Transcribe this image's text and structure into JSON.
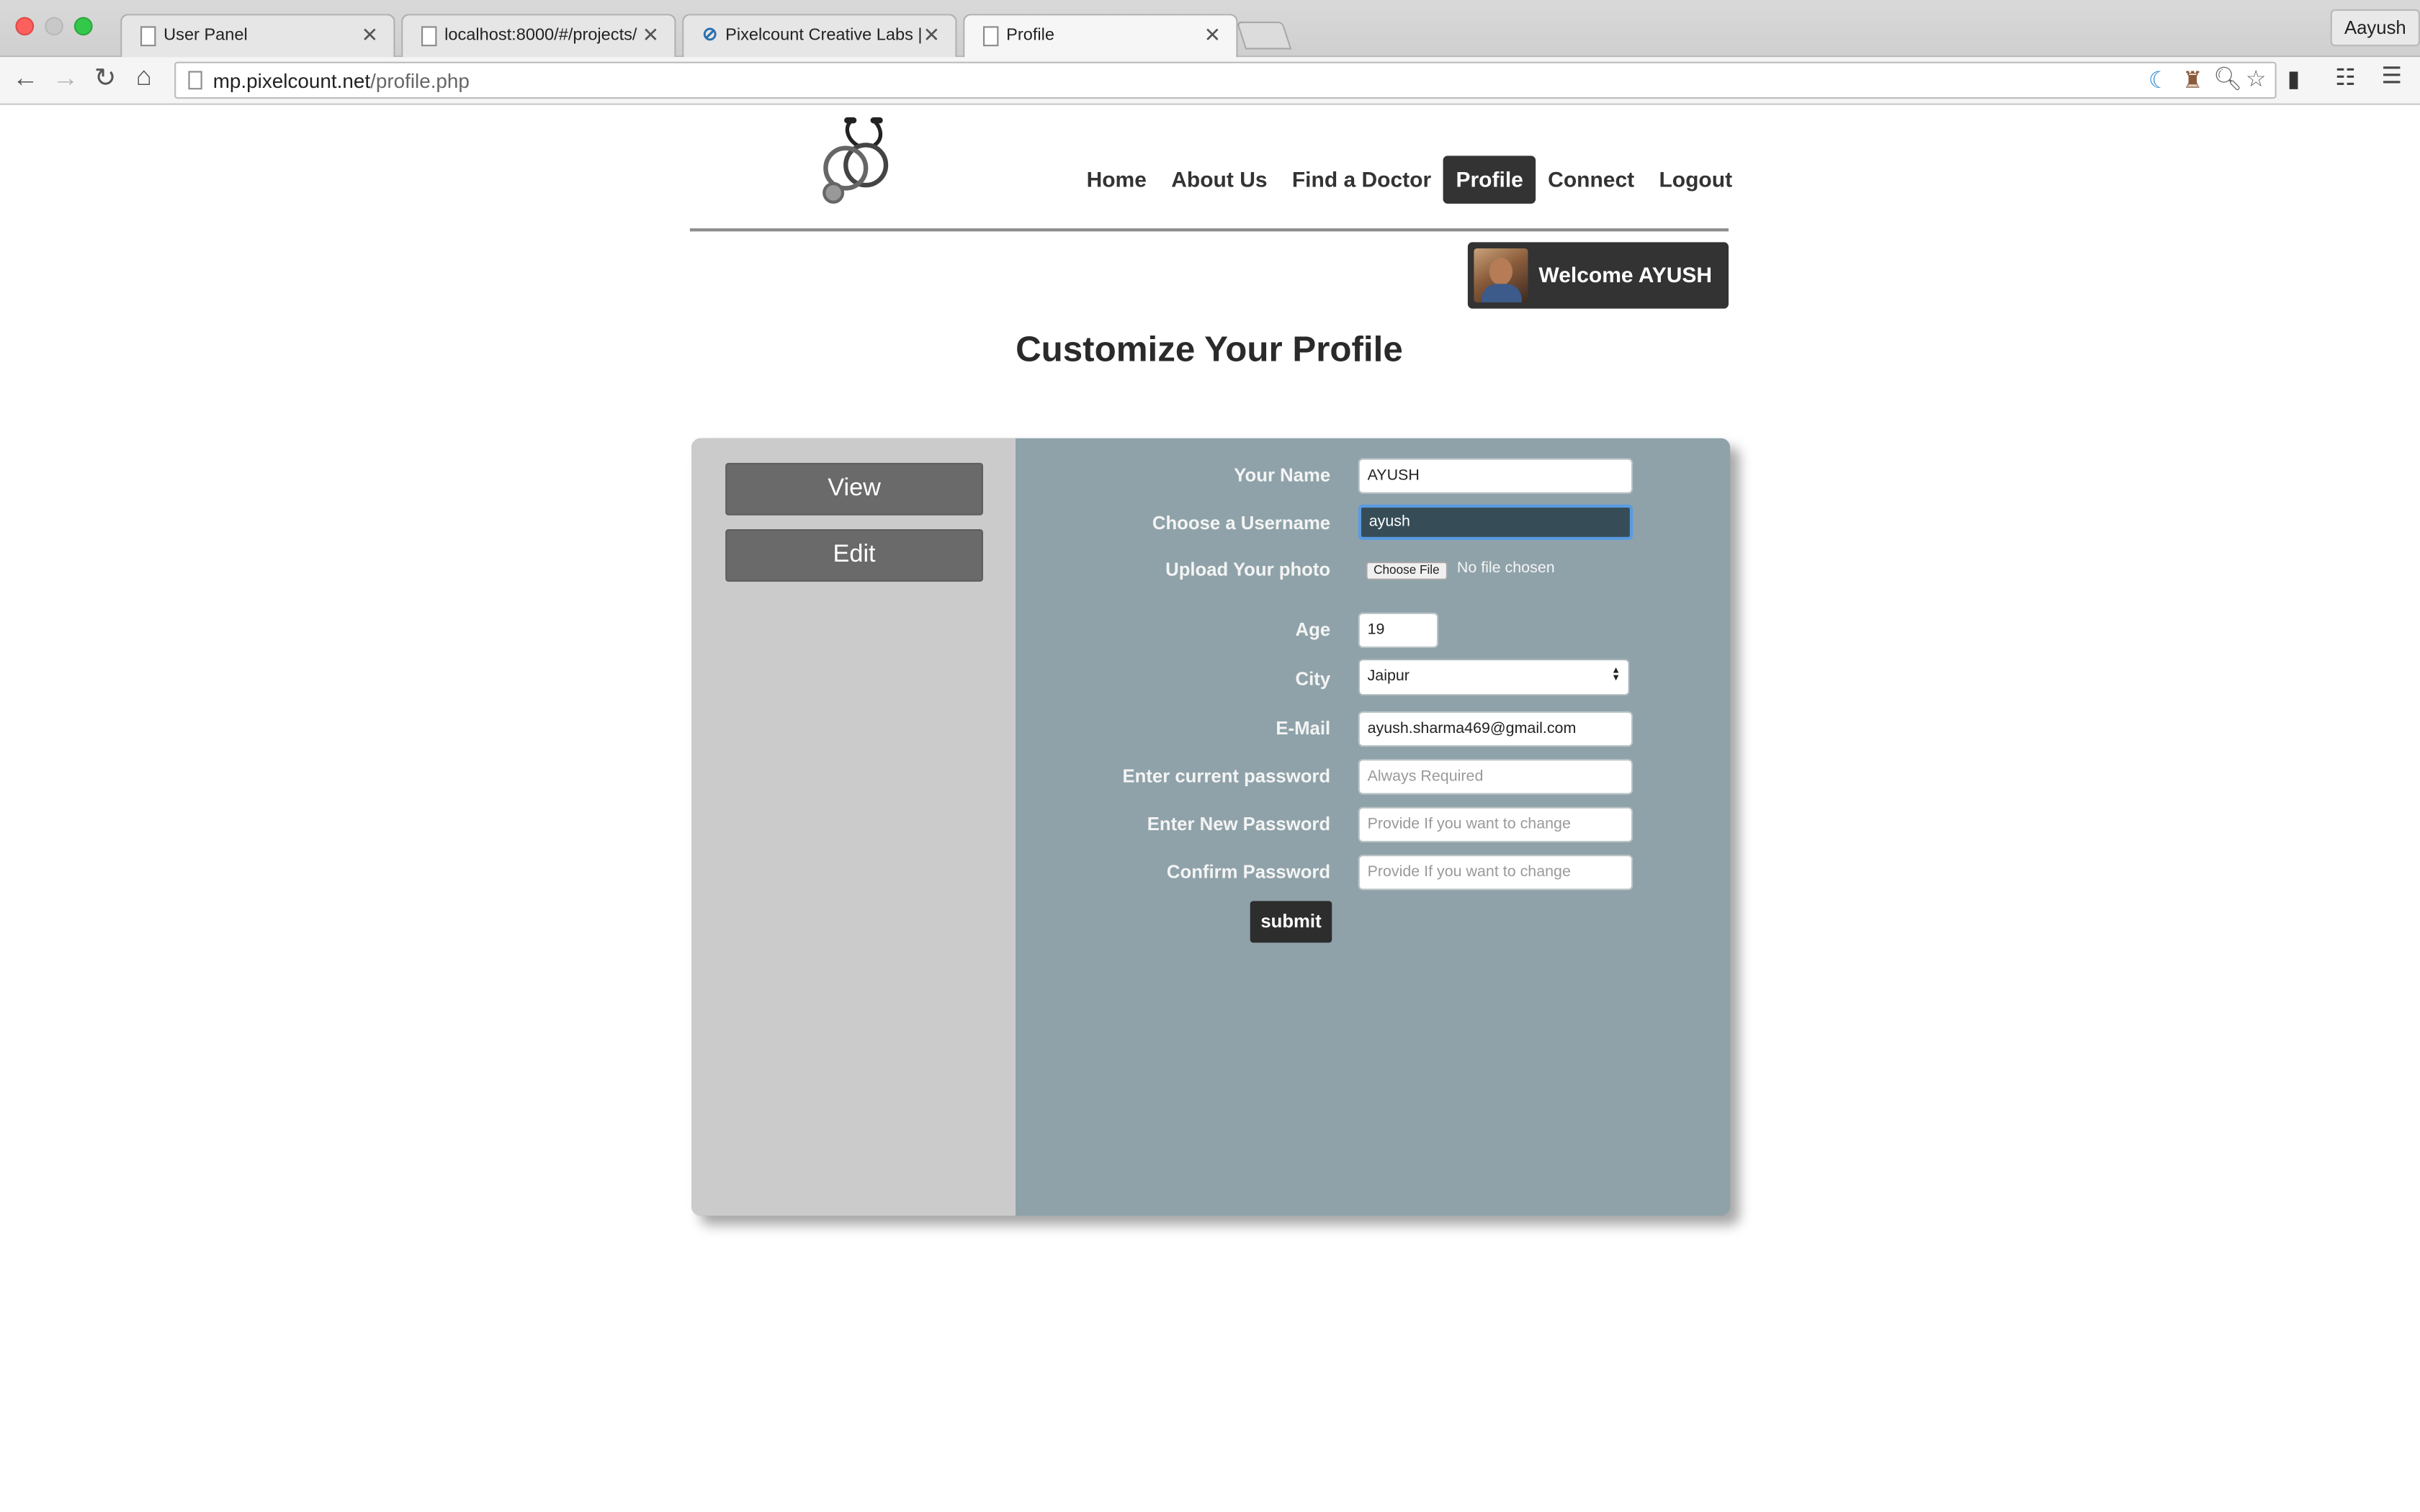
{
  "browser": {
    "tabs": [
      {
        "title": "User Panel"
      },
      {
        "title": "localhost:8000/#/projects/"
      },
      {
        "title": "Pixelcount Creative Labs | "
      },
      {
        "title": "Profile"
      }
    ],
    "user": "Aayush",
    "url_host": "mp.pixelcount.net",
    "url_path": "/profile.php"
  },
  "nav": {
    "items": [
      "Home",
      "About Us",
      "Find a Doctor",
      "Profile",
      "Connect",
      "Logout"
    ],
    "active": "Profile"
  },
  "welcome": "Welcome AYUSH",
  "page_title": "Customize Your Profile",
  "sidebar": {
    "view": "View",
    "edit": "Edit"
  },
  "form": {
    "name_label": "Your Name",
    "name_value": "AYUSH",
    "username_label": "Choose a Username",
    "username_value": "ayush",
    "photo_label": "Upload Your photo",
    "choose_file": "Choose File",
    "no_file": "No file chosen",
    "age_label": "Age",
    "age_value": "19",
    "city_label": "City",
    "city_value": "Jaipur",
    "email_label": "E-Mail",
    "email_value": "ayush.sharma469@gmail.com",
    "current_pw_label": "Enter current password",
    "current_pw_placeholder": "Always Required",
    "new_pw_label": "Enter New Password",
    "new_pw_placeholder": "Provide If you want to change",
    "confirm_pw_label": "Confirm Password",
    "confirm_pw_placeholder": "Provide If you want to change",
    "submit": "submit"
  },
  "colors": {
    "nav_active": "#333333",
    "panel_bg": "#8fa2a9",
    "sidebar_bg": "#cbcbcb",
    "sidebar_button": "#6a6a6a",
    "focus_field": "#364d58"
  }
}
